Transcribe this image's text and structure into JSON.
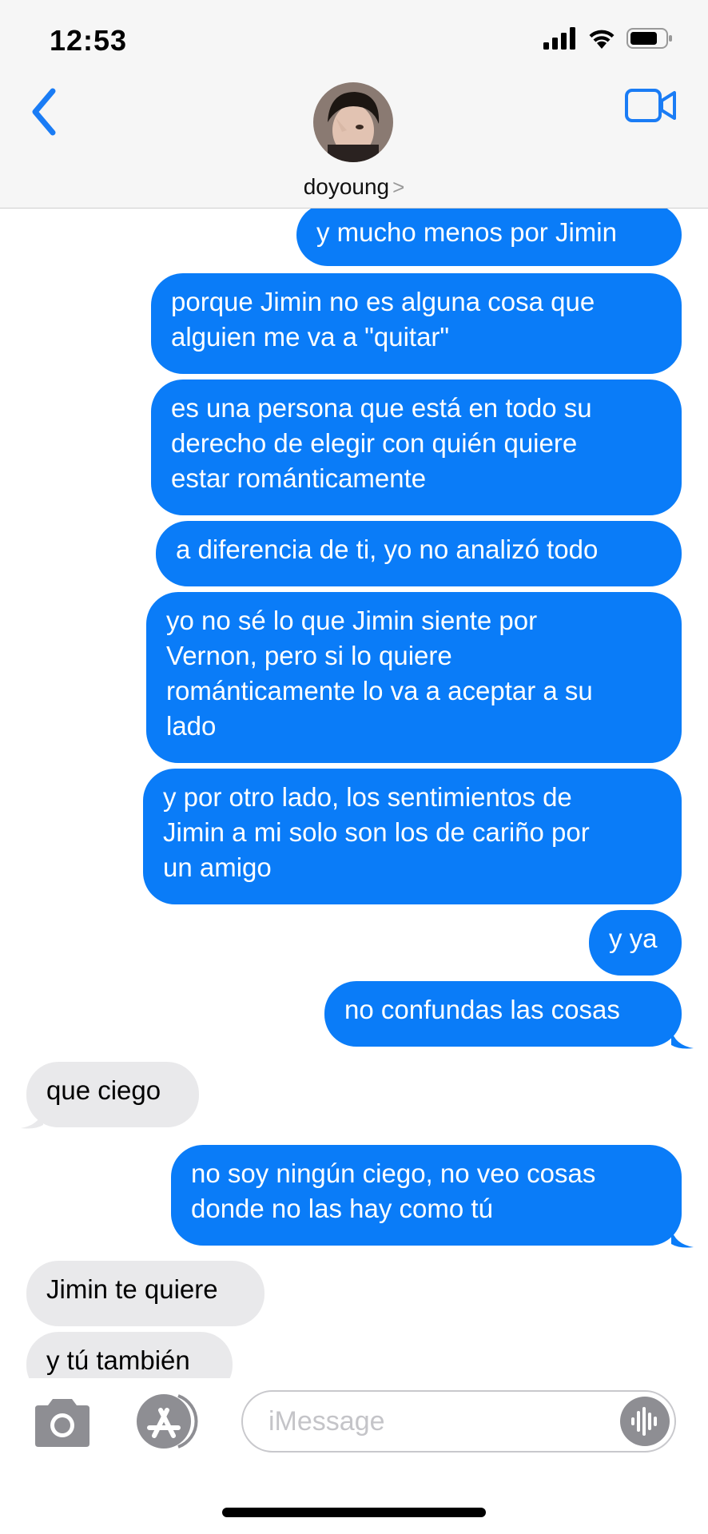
{
  "status_bar": {
    "time": "12:53"
  },
  "header": {
    "contact_name": "doyoung",
    "chevron": ">"
  },
  "messages": [
    {
      "from": "me",
      "text": "y mucho menos por Jimin"
    },
    {
      "from": "me",
      "text": "porque Jimin no es alguna cosa que\nalguien me va a \"quitar\""
    },
    {
      "from": "me",
      "text": "es una persona que está en todo su\nderecho de elegir con quién quiere\nestar románticamente"
    },
    {
      "from": "me",
      "text": "a diferencia de ti, yo no analizó todo"
    },
    {
      "from": "me",
      "text": "yo no sé lo que Jimin siente por\nVernon, pero si lo quiere\nrománticamente lo va a aceptar a su\nlado"
    },
    {
      "from": "me",
      "text": "y por otro lado, los sentimientos de\nJimin a mi solo son los de cariño por\nun amigo"
    },
    {
      "from": "me",
      "text": "y ya"
    },
    {
      "from": "me",
      "text": "no confundas las cosas"
    },
    {
      "from": "them",
      "text": "que ciego"
    },
    {
      "from": "me",
      "text": "no soy ningún ciego, no veo cosas\ndonde no las hay como tú"
    },
    {
      "from": "them",
      "text": "Jimin te quiere"
    },
    {
      "from": "them",
      "text": "y tú también"
    }
  ],
  "input": {
    "placeholder": "iMessage"
  },
  "colors": {
    "sent_bubble": "#0a7cf8",
    "received_bubble": "#e9e9eb",
    "accent": "#1a7cf5"
  },
  "icons": [
    "back-chevron-icon",
    "video-camera-icon",
    "camera-icon",
    "app-store-icon",
    "audio-waveform-icon",
    "signal-icon",
    "wifi-icon",
    "battery-icon"
  ]
}
